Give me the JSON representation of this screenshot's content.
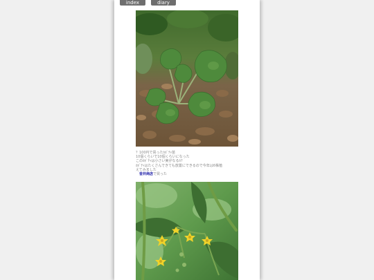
{
  "nav": {
    "index_label": "index",
    "diary_index_label": "diary index"
  },
  "caption": {
    "lines": [
      "？100円で買ったｶﾎﾞﾁｬ苗",
      "10個くらいで10個くらいになった",
      "このｶﾎﾞﾁｬは小さい実がなるｶ?",
      "ｶﾎﾞﾁｬはたくさんできても放置にできるので今年は6株植",
      "えてみました"
    ],
    "shop_name": "音井商店",
    "shop_suffix": "で買った"
  },
  "colors": {
    "background": "#f0f0f0",
    "page": "#ffffff",
    "nav_button": "#6e6e6e",
    "link": "#1a1aa6",
    "caption_text": "#888888"
  },
  "images": {
    "photo1": "pumpkin-seedling-photo",
    "photo2": "tomato-flowers-photo"
  }
}
